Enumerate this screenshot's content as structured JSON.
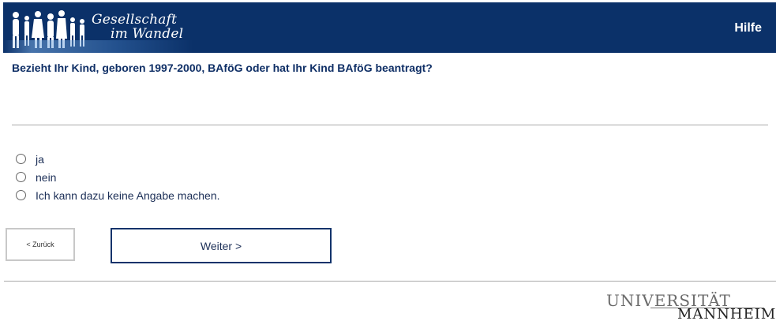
{
  "header": {
    "logo_line1": "Gesellschaft",
    "logo_line2": "im Wandel",
    "help_label": "Hilfe",
    "bg_color": "#0b3169"
  },
  "question": {
    "text": "Bezieht Ihr Kind, geboren 1997-2000, BAföG oder hat Ihr Kind BAföG beantragt?"
  },
  "options": [
    {
      "label": "ja",
      "selected": false
    },
    {
      "label": "nein",
      "selected": false
    },
    {
      "label": "Ich kann dazu keine Angabe machen.",
      "selected": false
    }
  ],
  "nav": {
    "back_label": "< Zurück",
    "next_label": "Weiter >"
  },
  "footer": {
    "uni_top": "UNIVERSITÄT",
    "uni_bottom": "MANNHEIM"
  }
}
